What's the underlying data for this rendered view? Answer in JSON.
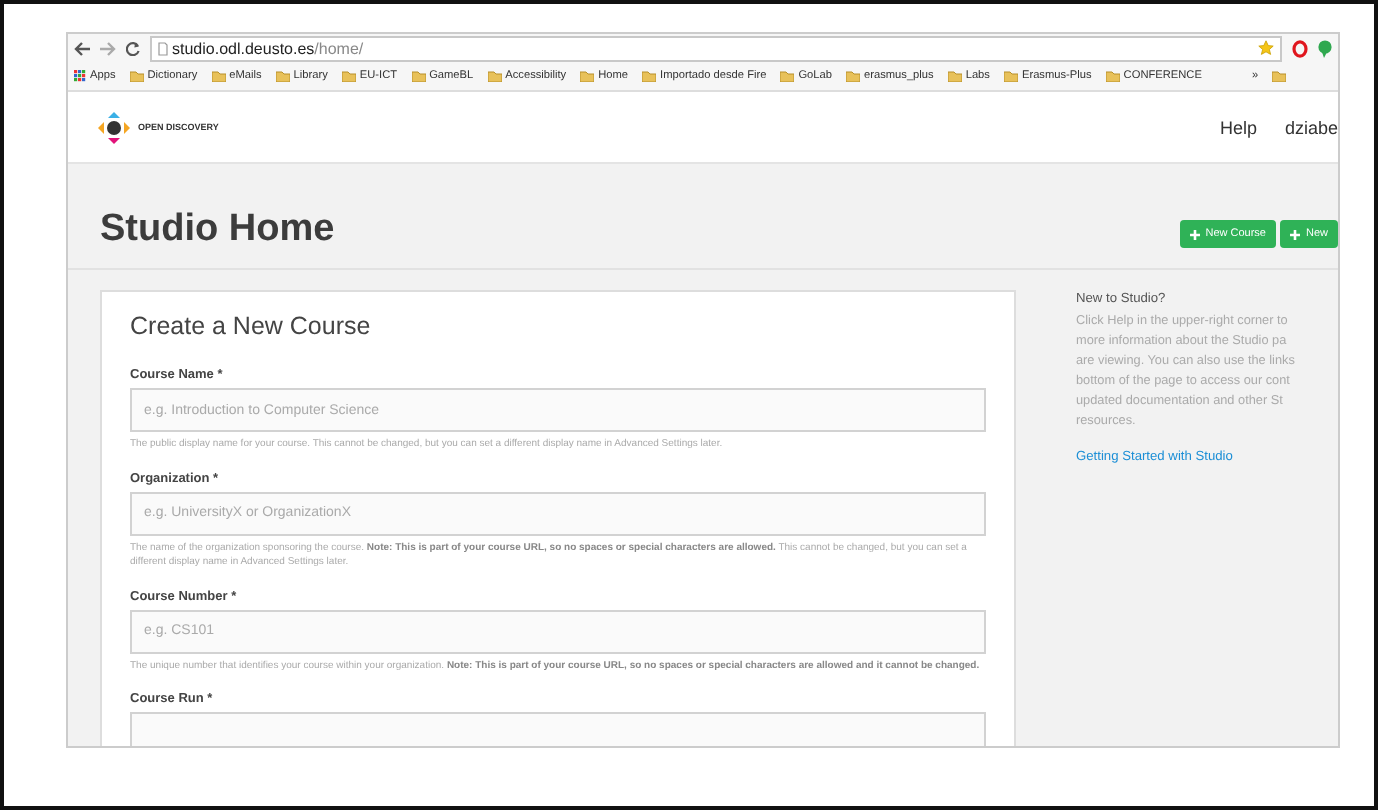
{
  "browser": {
    "url_host": "studio.odl.deusto.es",
    "url_path": "/home/",
    "bookmarks": [
      {
        "label": "Apps",
        "kind": "apps"
      },
      {
        "label": "Dictionary",
        "kind": "folder"
      },
      {
        "label": "eMails",
        "kind": "folder"
      },
      {
        "label": "Library",
        "kind": "folder"
      },
      {
        "label": "EU-ICT",
        "kind": "folder"
      },
      {
        "label": "GameBL",
        "kind": "folder"
      },
      {
        "label": "Accessibility",
        "kind": "folder"
      },
      {
        "label": "Home",
        "kind": "folder"
      },
      {
        "label": "Importado desde Fire",
        "kind": "folder"
      },
      {
        "label": "GoLab",
        "kind": "folder"
      },
      {
        "label": "erasmus_plus",
        "kind": "folder"
      },
      {
        "label": "Labs",
        "kind": "folder"
      },
      {
        "label": "Erasmus-Plus",
        "kind": "folder"
      },
      {
        "label": "CONFERENCE",
        "kind": "folder"
      }
    ],
    "overflow": "»"
  },
  "header": {
    "logo": "OPEN DISCOVERY",
    "nav": [
      "Help",
      "dziabe"
    ]
  },
  "page": {
    "title": "Studio Home",
    "buttons": [
      "New Course",
      "New"
    ]
  },
  "form": {
    "title": "Create a New Course",
    "fields": [
      {
        "label": "Course Name *",
        "placeholder": "e.g. Introduction to Computer Science",
        "help": "The public display name for your course. This cannot be changed, but you can set a different display name in Advanced Settings later."
      },
      {
        "label": "Organization *",
        "placeholder": "e.g. UniversityX or OrganizationX",
        "help": "The name of the organization sponsoring the course. **Note: This is part of your course URL, so no spaces or special characters are allowed.** This cannot be changed, but you can set a different display name in Advanced Settings later."
      },
      {
        "label": "Course Number *",
        "placeholder": "e.g. CS101",
        "help": "The unique number that identifies your course within your organization. **Note: This is part of your course URL, so no spaces or special characters are allowed and it cannot be changed.**"
      },
      {
        "label": "Course Run *"
      }
    ]
  },
  "sidebar": {
    "title": "New to Studio?",
    "lines": [
      "Click Help in the upper-right corner to",
      "more information about the Studio pa",
      "are viewing. You can also use the links",
      "bottom of the page to access our cont",
      "updated documentation and other St",
      "resources."
    ],
    "link": "Getting Started with Studio"
  }
}
